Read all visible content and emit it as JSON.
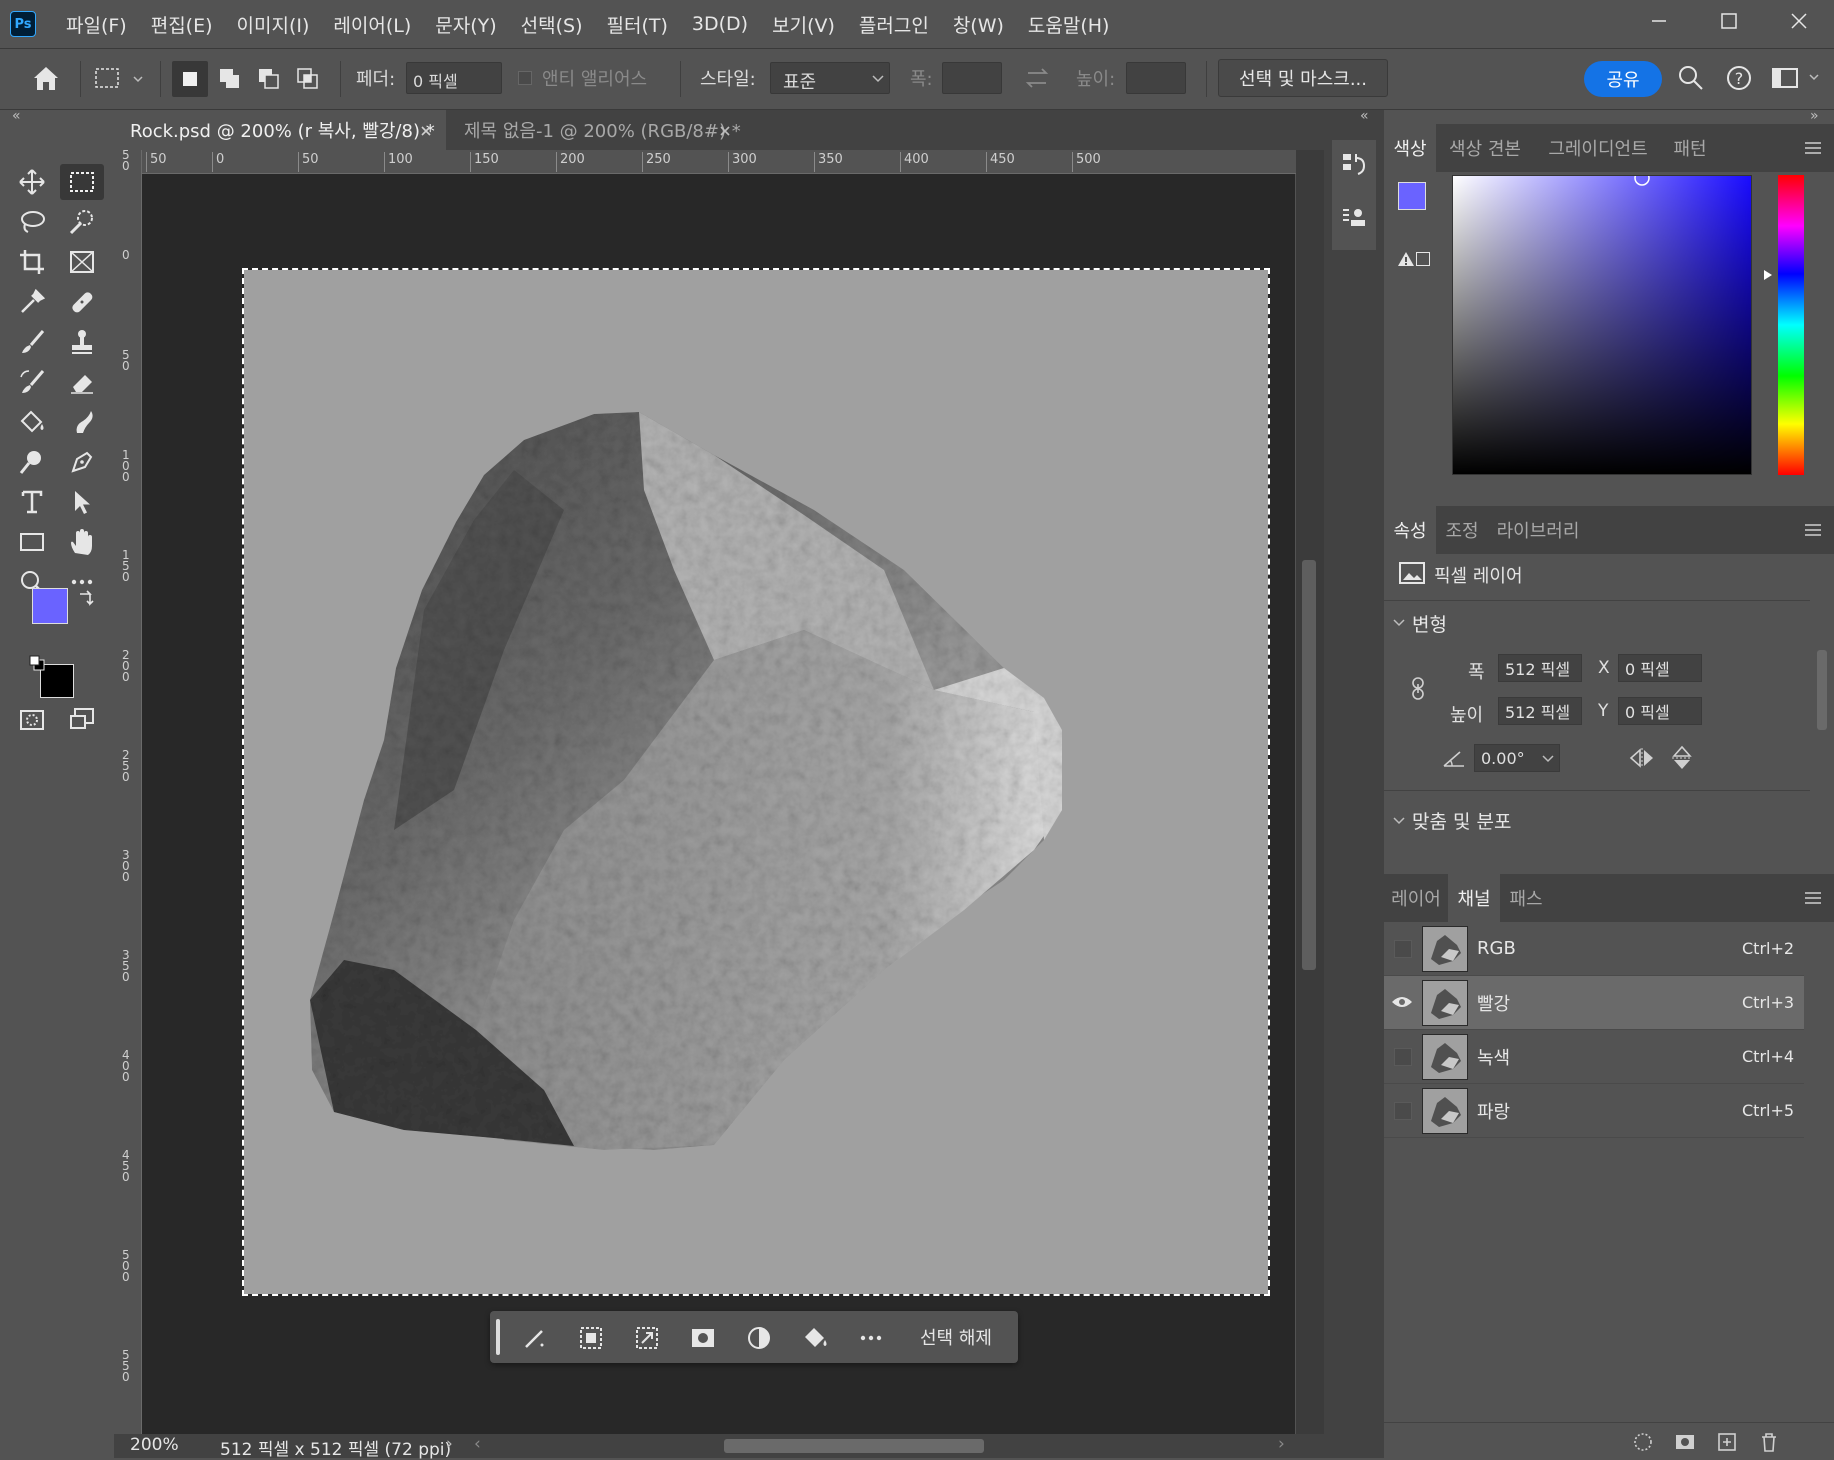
{
  "app": {
    "logo": "Ps"
  },
  "menu": [
    "파일(F)",
    "편집(E)",
    "이미지(I)",
    "레이어(L)",
    "문자(Y)",
    "선택(S)",
    "필터(T)",
    "3D(D)",
    "보기(V)",
    "플러그인",
    "창(W)",
    "도움말(H)"
  ],
  "options": {
    "feather_label": "페더:",
    "feather_value": "0 픽셀",
    "antialias_label": "앤티 앨리어스",
    "style_label": "스타일:",
    "style_value": "표준",
    "width_label": "폭:",
    "height_label": "높이:",
    "select_mask_label": "선택 및 마스크...",
    "share_label": "공유"
  },
  "tabs": [
    {
      "label": "Rock.psd @ 200% (r 복사, 빨강/8) *",
      "active": true
    },
    {
      "label": "제목 없음-1 @ 200% (RGB/8#) *",
      "active": false
    }
  ],
  "ruler": {
    "h_ticks": [
      "50",
      "0",
      "50",
      "100",
      "150",
      "200",
      "250",
      "300",
      "350",
      "400",
      "450",
      "500"
    ],
    "v_ticks": [
      "5 0",
      "0",
      "5 0",
      "1 0 0",
      "1 5 0",
      "2 0 0",
      "2 5 0",
      "3 0 0",
      "3 5 0",
      "4 0 0",
      "4 5 0",
      "5 0 0",
      "5 5 0"
    ]
  },
  "colors": {
    "foreground": "#6a63ff",
    "background": "#000000",
    "accent": "#1473e6",
    "canvas_gray": "#a0a0a0"
  },
  "taskbar": {
    "deselect_label": "선택 해제"
  },
  "status": {
    "zoom": "200%",
    "doc_info": "512 픽셀 x 512 픽셀 (72 ppi)"
  },
  "color_panel": {
    "tabs": [
      "색상",
      "색상 견본",
      "그레이디언트",
      "패턴"
    ]
  },
  "properties_panel": {
    "tabs": [
      "속성",
      "조정",
      "라이브러리"
    ],
    "layer_type": "픽셀 레이어",
    "transform_title": "변형",
    "width_label": "폭",
    "height_label": "높이",
    "width_value": "512 픽셀",
    "height_value": "512 픽셀",
    "x_label": "X",
    "y_label": "Y",
    "x_value": "0 픽셀",
    "y_value": "0 픽셀",
    "angle_value": "0.00°",
    "align_title": "맞춤 및 분포"
  },
  "channels_panel": {
    "tabs": [
      "레이어",
      "채널",
      "패스"
    ],
    "channels": [
      {
        "name": "RGB",
        "shortcut": "Ctrl+2",
        "visible": false,
        "selected": false
      },
      {
        "name": "빨강",
        "shortcut": "Ctrl+3",
        "visible": true,
        "selected": true
      },
      {
        "name": "녹색",
        "shortcut": "Ctrl+4",
        "visible": false,
        "selected": false
      },
      {
        "name": "파랑",
        "shortcut": "Ctrl+5",
        "visible": false,
        "selected": false
      }
    ]
  }
}
